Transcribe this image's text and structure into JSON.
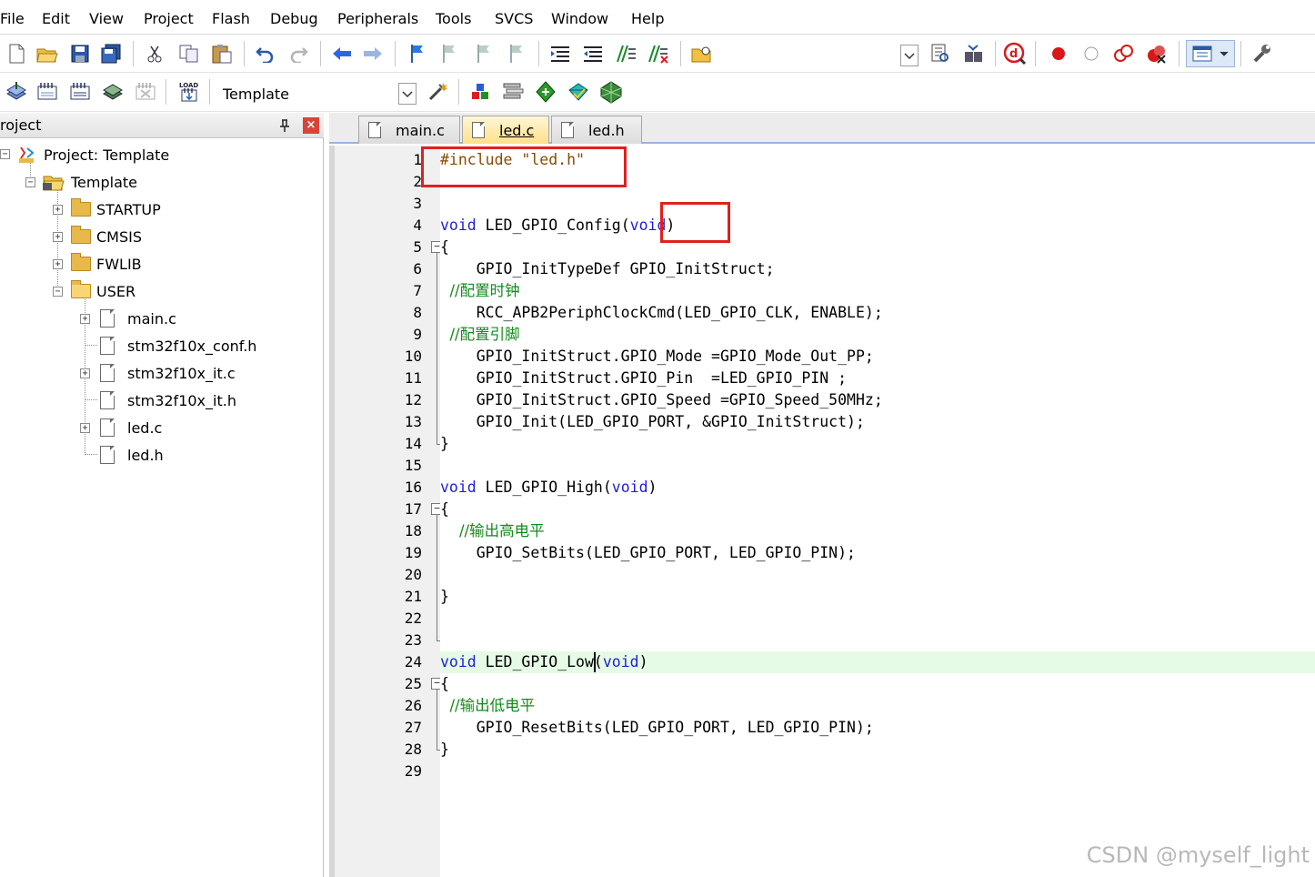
{
  "menu": [
    "File",
    "Edit",
    "View",
    "Project",
    "Flash",
    "Debug",
    "Peripherals",
    "Tools",
    "SVCS",
    "Window",
    "Help"
  ],
  "toolbar2": {
    "target": "Template"
  },
  "project_panel": {
    "title": "roject",
    "close": "×",
    "tree": {
      "project": "Project: Template",
      "target": "Template",
      "groups": [
        "STARTUP",
        "CMSIS",
        "FWLIB",
        "USER"
      ],
      "user_files": [
        "main.c",
        "stm32f10x_conf.h",
        "stm32f10x_it.c",
        "stm32f10x_it.h",
        "led.c",
        "led.h"
      ]
    }
  },
  "tabs": [
    {
      "label": "main.c",
      "active": false
    },
    {
      "label": "led.c",
      "active": true
    },
    {
      "label": "led.h",
      "active": false
    }
  ],
  "code_lines": [
    "#include \"led.h\"",
    "",
    "",
    "void LED_GPIO_Config(void)",
    "{",
    "    GPIO_InitTypeDef GPIO_InitStruct;",
    "  //配置时钟",
    "    RCC_APB2PeriphClockCmd(LED_GPIO_CLK, ENABLE);",
    "  //配置引脚",
    "    GPIO_InitStruct.GPIO_Mode =GPIO_Mode_Out_PP;",
    "    GPIO_InitStruct.GPIO_Pin  =LED_GPIO_PIN ;",
    "    GPIO_InitStruct.GPIO_Speed =GPIO_Speed_50MHz;",
    "    GPIO_Init(LED_GPIO_PORT, &GPIO_InitStruct);",
    "}",
    "",
    "void LED_GPIO_High(void)",
    "{",
    "    //输出高电平",
    "    GPIO_SetBits(LED_GPIO_PORT, LED_GPIO_PIN);",
    "",
    "}",
    "",
    "",
    "void LED_GPIO_Low(void)",
    "{",
    "  //输出低电平",
    "    GPIO_ResetBits(LED_GPIO_PORT, LED_GPIO_PIN);",
    "}",
    ""
  ],
  "current_line": 24,
  "watermark": "CSDN @myself_light",
  "colors": {
    "keyword": "#1e1ed6",
    "comment": "#118b1c",
    "preprocessor": "#8a4a00",
    "highlight_box": "#e02020",
    "current_line_bg": "#e6fbe6"
  }
}
